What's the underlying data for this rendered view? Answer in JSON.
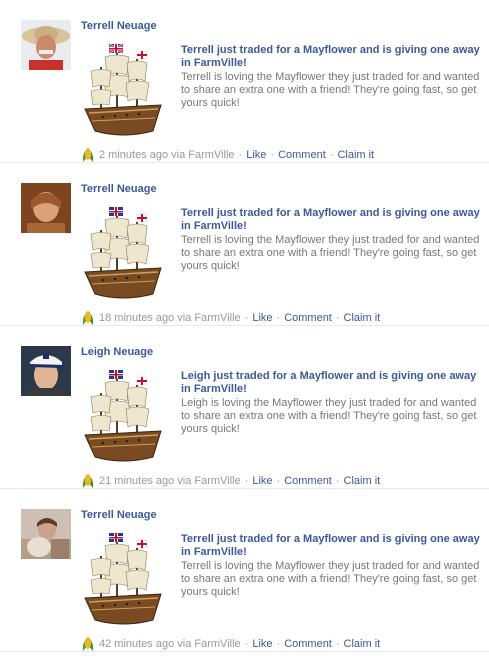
{
  "stories": [
    {
      "actor": "Terrell Neuage",
      "title": "Terrell just traded for a Mayflower and is giving one away in FarmVille!",
      "description": "Terrell is loving the Mayflower they just traded for and wanted to share an extra one with a friend! They're going fast, so get yours quick!",
      "time": "2 minutes ago",
      "via": "via FarmVille",
      "actions": [
        "Like",
        "Comment",
        "Claim it"
      ],
      "avatar_icon": "man-with-straw-hat",
      "thumb_icon": "mayflower-ship-icon"
    },
    {
      "actor": "Terrell Neuage",
      "title": "Terrell just traded for a Mayflower and is giving one away in FarmVille!",
      "description": "Terrell is loving the Mayflower they just traded for and wanted to share an extra one with a friend! They're going fast, so get yours quick!",
      "time": "18 minutes ago",
      "via": "via FarmVille",
      "actions": [
        "Like",
        "Comment",
        "Claim it"
      ],
      "avatar_icon": "sepia-portrait",
      "thumb_icon": "mayflower-ship-icon"
    },
    {
      "actor": "Leigh Neuage",
      "title": "Leigh just traded for a Mayflower and is giving one away in FarmVille!",
      "description": "Leigh is loving the Mayflower they just traded for and wanted to share an extra one with a friend! They're going fast, so get yours quick!",
      "time": "21 minutes ago",
      "via": "via FarmVille",
      "actions": [
        "Like",
        "Comment",
        "Claim it"
      ],
      "avatar_icon": "man-with-cap",
      "thumb_icon": "mayflower-ship-icon"
    },
    {
      "actor": "Terrell Neuage",
      "title": "Terrell just traded for a Mayflower and is giving one away in FarmVille!",
      "description": "Terrell is loving the Mayflower they just traded for and wanted to share an extra one with a friend! They're going fast, so get yours quick!",
      "time": "42 minutes ago",
      "via": "via FarmVille",
      "actions": [
        "Like",
        "Comment",
        "Claim it"
      ],
      "avatar_icon": "child-portrait",
      "thumb_icon": "mayflower-ship-icon"
    }
  ],
  "colors": {
    "link": "#3b5998",
    "meta_text": "#999999",
    "description": "#777777",
    "divider": "#e9e9e9"
  }
}
